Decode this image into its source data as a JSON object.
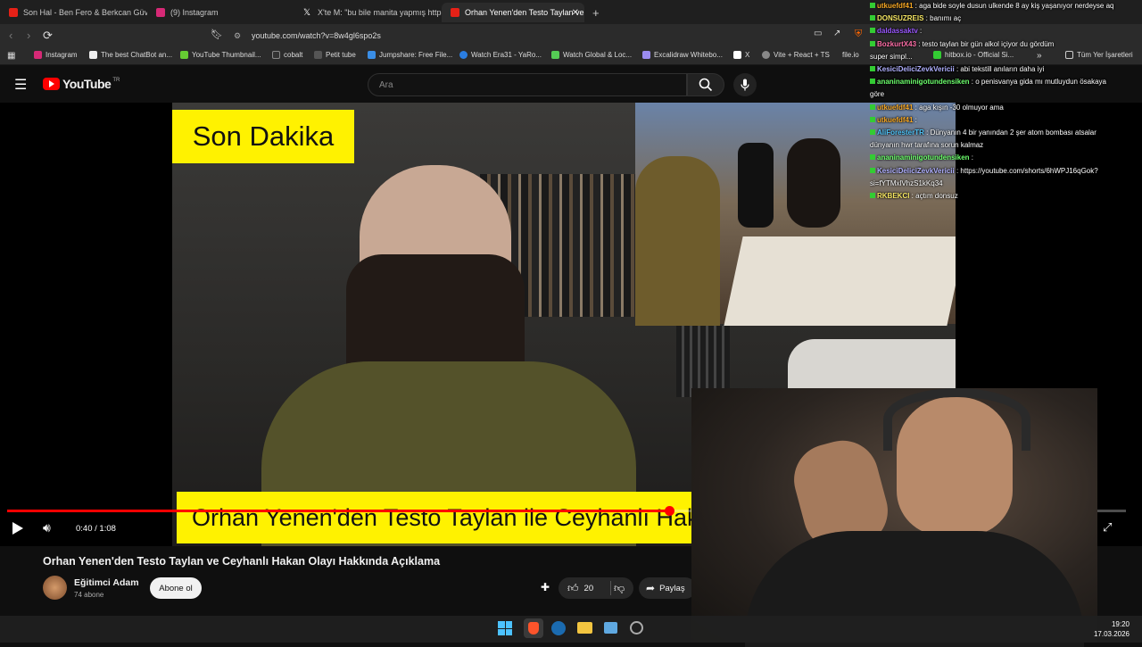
{
  "browser": {
    "tabs": [
      {
        "label": "Son Hal - Ben Fero & Berkcan Güven",
        "favicon_color": "#e62117"
      },
      {
        "label": "(9) Instagram",
        "favicon_color": "#d62976"
      },
      {
        "label": "X'te M: \"bu bile manita yapmış https:",
        "favicon_color": "#ffffff"
      },
      {
        "label": "Orhan Yenen'den Testo Taylan ve",
        "favicon_color": "#e62117"
      }
    ],
    "new_tab": "+",
    "url": "youtube.com/watch?v=8w4gl6spo2s",
    "bookmarks": [
      "Instagram",
      "The best ChatBot an...",
      "YouTube Thumbnail...",
      "cobalt",
      "Petit tube",
      "Jumpshare: Free File...",
      "Watch Era31 - YaRo...",
      "Watch Global & Loc...",
      "Excalidraw Whitebo...",
      "X",
      "Vite + React + TS",
      "file.io",
      "hitbox.io - Official Si..."
    ],
    "bookmarks_more": "»",
    "all_bookmarks": "Tüm Yer İşaretleri"
  },
  "youtube": {
    "logo_text": "YouTube",
    "logo_region": "TR",
    "search_placeholder": "Ara"
  },
  "video": {
    "overlay_top": "Son Dakika",
    "overlay_bottom": "Orhan Yenen'den Testo Taylan ile Ceyhanlı Hakan",
    "time": "0:40 / 1:08",
    "progress": 0.592,
    "title": "Orhan Yenen'den Testo Taylan ve Ceyhanlı Hakan Olayı Hakkında Açıklama",
    "channel": "Eğitimci Adam",
    "subscribers": "74 abone",
    "subscribe_label": "Abone ol",
    "likes": "20",
    "share_label": "Paylaş"
  },
  "chat": [
    {
      "user": "utkuefdf41",
      "color": "#f5a623",
      "text": ": aga bide soyle dusun ulkende 8 ay kiş yaşanıyor nerdeyse aq"
    },
    {
      "user": "DONSUZREIS",
      "color": "#f5e663",
      "text": ": banımı aç"
    },
    {
      "user": "daldassaktv",
      "color": "#9b59ff",
      "text": ":"
    },
    {
      "user": "BozkurtX43",
      "color": "#ff6fa8",
      "text": ": testo taylan bir gün alkol içiyor du gördüm"
    },
    {
      "user": "",
      "color": "#ffffff",
      "text": "super simpl..."
    },
    {
      "user": "KesiciDeliciZevkVericii",
      "color": "#b0b0ff",
      "text": ": abi tekstill anıların daha iyi"
    },
    {
      "user": "ananinaminigotundensiken",
      "color": "#6cff6c",
      "text": ": o penisvanya gida mı mutluydun ösakaya"
    },
    {
      "user": "",
      "color": "#ffffff",
      "text": "göre"
    },
    {
      "user": "utkuefdf41",
      "color": "#f5a623",
      "text": ": aga kışın -30 olmuyor ama"
    },
    {
      "user": "utkuefdf41",
      "color": "#f5a623",
      "text": ":"
    },
    {
      "user": "AliForesterTR",
      "color": "#4fc3f7",
      "text": ": Dünyanın 4 bir yanından 2 şer atom bombası atsalar"
    },
    {
      "user": "",
      "color": "#ffffff",
      "text": "dünyanın hwr tarafına sorun kalmaz"
    },
    {
      "user": "ananinaminigotundensiken",
      "color": "#6cff6c",
      "text": ":"
    },
    {
      "user": "KesiciDeliciZevkVericii",
      "color": "#b0b0ff",
      "text": ": https://youtube.com/shorts/6hWPJ16qGok?"
    },
    {
      "user": "",
      "color": "#ffffff",
      "text": "si=fYTMxlVhzS1kKq34"
    },
    {
      "user": "RKBEKCI",
      "color": "#f5e663",
      "text": ": açtım donsuz"
    }
  ],
  "taskbar": {
    "time": "19:20",
    "date": "17.03.2026"
  }
}
